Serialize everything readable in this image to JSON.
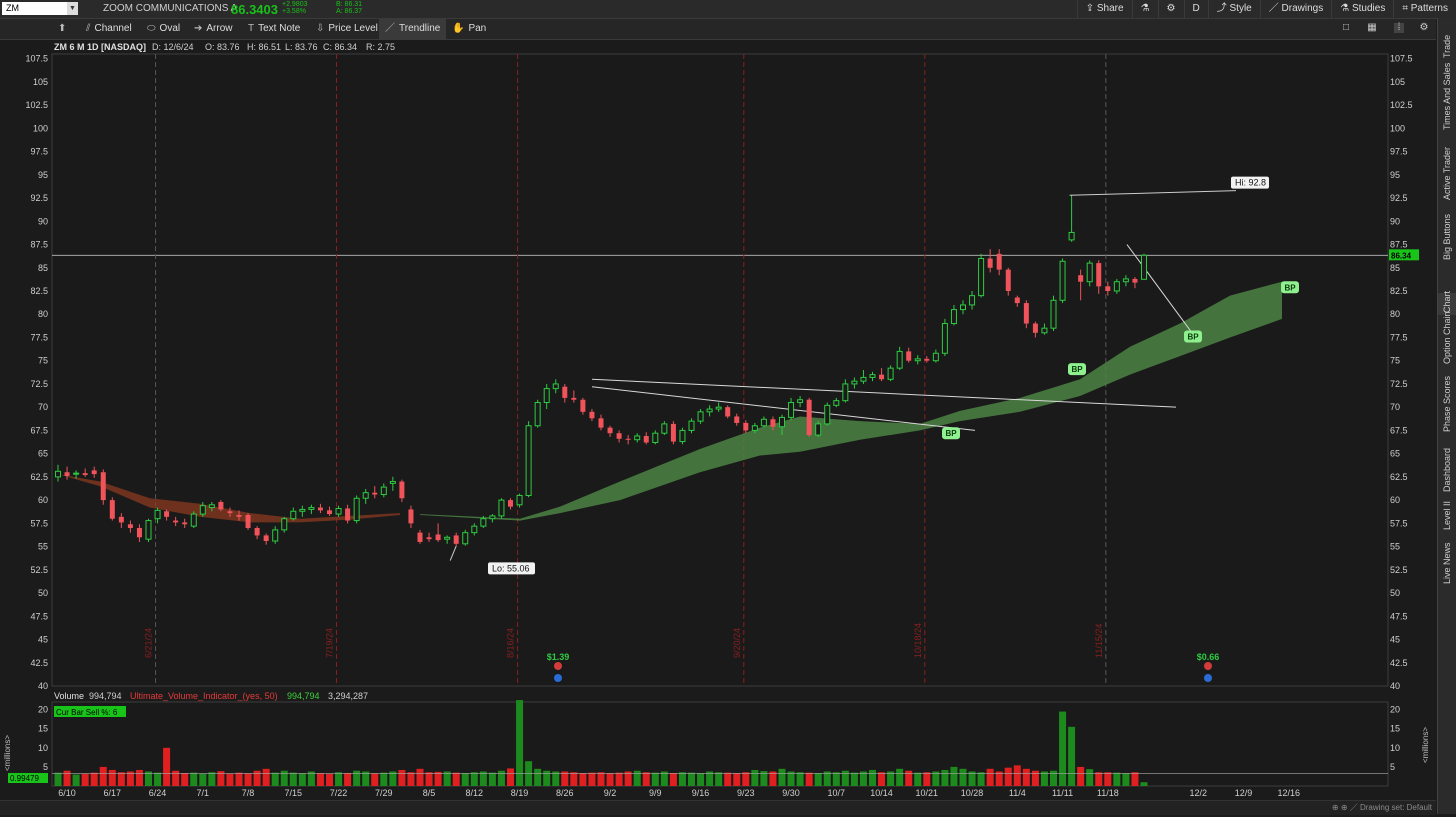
{
  "header": {
    "symbol": "ZM",
    "company": "ZOOM COMMUNICATIONS A",
    "last": "86.3403",
    "change": "+2.9803",
    "change_pct": "+3.58%",
    "bid": "B: 86.31",
    "ask": "A: 86.37",
    "buttons": [
      "Share",
      "D",
      "Style",
      "Drawings",
      "Studies",
      "Patterns"
    ]
  },
  "drawing_tools": [
    "Channel",
    "Oval",
    "Arrow",
    "Text Note",
    "Price Level",
    "Trendline",
    "Pan"
  ],
  "active_tool": "Trendline",
  "sidebar_tabs": [
    "Trade",
    "Times And Sales",
    "Active Trader",
    "Big Buttons",
    "Chart",
    "Option Chain",
    "Phase Scores",
    "Dashboard",
    "Level II",
    "Live News"
  ],
  "chart_data": {
    "type": "candlestick",
    "info": {
      "title": "ZM 6 M 1D [NASDAQ]",
      "date": "D: 12/6/24",
      "open": "O: 83.76",
      "high": "H: 86.51",
      "low": "L: 83.76",
      "close": "C: 86.34",
      "range": "R: 2.75"
    },
    "y_ticks": [
      "107.5",
      "105",
      "102.5",
      "100",
      "97.5",
      "95",
      "92.5",
      "90",
      "87.5",
      "85",
      "82.5",
      "80",
      "77.5",
      "75",
      "72.5",
      "70",
      "67.5",
      "65",
      "62.5",
      "60",
      "57.5",
      "55",
      "52.5",
      "50",
      "47.5",
      "45",
      "42.5",
      "40"
    ],
    "ylim": [
      40,
      108
    ],
    "x_ticks": [
      "6/10",
      "6/17",
      "6/24",
      "7/1",
      "7/8",
      "7/15",
      "7/22",
      "7/29",
      "8/5",
      "8/12",
      "8/19",
      "8/26",
      "9/2",
      "9/9",
      "9/16",
      "9/23",
      "9/30",
      "10/7",
      "10/14",
      "10/21",
      "10/28",
      "11/4",
      "11/11",
      "11/18",
      "12/2",
      "12/9",
      "12/16"
    ],
    "marker_dates": [
      "6/21/24",
      "7/19/24",
      "8/16/24",
      "9/20/24",
      "10/18/24",
      "11/15/24"
    ],
    "last_price_label": "86.34",
    "hi_label": "Hi: 92.8",
    "lo_label": "Lo: 55.06",
    "earnings": [
      "$1.39",
      "$0.66"
    ],
    "bp_labels": [
      "BP",
      "BP",
      "BP",
      "BP"
    ],
    "candles": [
      {
        "o": 62.5,
        "h": 63.8,
        "l": 62.0,
        "c": 63.1
      },
      {
        "o": 63.0,
        "h": 63.6,
        "l": 62.2,
        "c": 62.6
      },
      {
        "o": 62.8,
        "h": 63.2,
        "l": 62.3,
        "c": 62.9
      },
      {
        "o": 62.9,
        "h": 63.4,
        "l": 62.5,
        "c": 62.7
      },
      {
        "o": 63.2,
        "h": 63.6,
        "l": 62.4,
        "c": 62.8
      },
      {
        "o": 63.0,
        "h": 63.3,
        "l": 59.5,
        "c": 60.0
      },
      {
        "o": 60.0,
        "h": 60.3,
        "l": 57.8,
        "c": 58.0
      },
      {
        "o": 58.2,
        "h": 58.6,
        "l": 57.0,
        "c": 57.6
      },
      {
        "o": 57.4,
        "h": 57.8,
        "l": 56.5,
        "c": 57.0
      },
      {
        "o": 57.0,
        "h": 57.4,
        "l": 55.5,
        "c": 56.0
      },
      {
        "o": 55.8,
        "h": 58.0,
        "l": 55.5,
        "c": 57.8
      },
      {
        "o": 58.0,
        "h": 59.2,
        "l": 57.5,
        "c": 58.9
      },
      {
        "o": 58.8,
        "h": 59.0,
        "l": 57.8,
        "c": 58.2
      },
      {
        "o": 57.8,
        "h": 58.2,
        "l": 57.2,
        "c": 57.6
      },
      {
        "o": 57.6,
        "h": 58.0,
        "l": 57.0,
        "c": 57.4
      },
      {
        "o": 57.2,
        "h": 58.8,
        "l": 57.0,
        "c": 58.5
      },
      {
        "o": 58.5,
        "h": 59.8,
        "l": 58.2,
        "c": 59.4
      },
      {
        "o": 59.2,
        "h": 59.8,
        "l": 58.8,
        "c": 59.5
      },
      {
        "o": 59.8,
        "h": 60.0,
        "l": 58.8,
        "c": 59.0
      },
      {
        "o": 58.8,
        "h": 59.2,
        "l": 58.2,
        "c": 58.6
      },
      {
        "o": 58.4,
        "h": 58.9,
        "l": 57.8,
        "c": 58.2
      },
      {
        "o": 58.4,
        "h": 58.6,
        "l": 56.8,
        "c": 57.0
      },
      {
        "o": 57.0,
        "h": 57.2,
        "l": 55.8,
        "c": 56.2
      },
      {
        "o": 56.2,
        "h": 56.4,
        "l": 55.2,
        "c": 55.6
      },
      {
        "o": 55.6,
        "h": 57.2,
        "l": 55.3,
        "c": 56.8
      },
      {
        "o": 56.8,
        "h": 58.2,
        "l": 56.5,
        "c": 58.0
      },
      {
        "o": 58.0,
        "h": 59.2,
        "l": 57.8,
        "c": 58.8
      },
      {
        "o": 58.8,
        "h": 59.4,
        "l": 58.2,
        "c": 59.0
      },
      {
        "o": 59.0,
        "h": 59.5,
        "l": 58.5,
        "c": 59.2
      },
      {
        "o": 59.2,
        "h": 59.6,
        "l": 58.6,
        "c": 58.9
      },
      {
        "o": 58.9,
        "h": 59.3,
        "l": 58.3,
        "c": 58.5
      },
      {
        "o": 58.5,
        "h": 59.4,
        "l": 58.2,
        "c": 59.1
      },
      {
        "o": 59.1,
        "h": 59.5,
        "l": 57.5,
        "c": 57.8
      },
      {
        "o": 57.8,
        "h": 60.5,
        "l": 57.5,
        "c": 60.2
      },
      {
        "o": 60.2,
        "h": 61.2,
        "l": 59.6,
        "c": 60.8
      },
      {
        "o": 60.8,
        "h": 61.5,
        "l": 60.2,
        "c": 60.6
      },
      {
        "o": 60.6,
        "h": 61.8,
        "l": 60.3,
        "c": 61.4
      },
      {
        "o": 61.8,
        "h": 62.5,
        "l": 61.0,
        "c": 62.0
      },
      {
        "o": 62.0,
        "h": 62.2,
        "l": 59.8,
        "c": 60.2
      },
      {
        "o": 59.0,
        "h": 59.4,
        "l": 57.0,
        "c": 57.5
      },
      {
        "o": 56.5,
        "h": 56.8,
        "l": 55.3,
        "c": 55.5
      },
      {
        "o": 56.0,
        "h": 56.5,
        "l": 55.5,
        "c": 55.8
      },
      {
        "o": 56.3,
        "h": 57.5,
        "l": 55.5,
        "c": 55.7
      },
      {
        "o": 55.8,
        "h": 56.2,
        "l": 55.3,
        "c": 56.0
      },
      {
        "o": 56.2,
        "h": 56.5,
        "l": 55.06,
        "c": 55.3
      },
      {
        "o": 55.3,
        "h": 56.8,
        "l": 55.1,
        "c": 56.5
      },
      {
        "o": 56.5,
        "h": 57.5,
        "l": 56.2,
        "c": 57.2
      },
      {
        "o": 57.2,
        "h": 58.3,
        "l": 57.0,
        "c": 58.0
      },
      {
        "o": 58.0,
        "h": 58.5,
        "l": 57.6,
        "c": 58.3
      },
      {
        "o": 58.3,
        "h": 60.2,
        "l": 58.0,
        "c": 60.0
      },
      {
        "o": 60.0,
        "h": 60.2,
        "l": 59.0,
        "c": 59.3
      },
      {
        "o": 59.5,
        "h": 60.7,
        "l": 59.2,
        "c": 60.5
      },
      {
        "o": 60.5,
        "h": 68.5,
        "l": 60.3,
        "c": 68.0
      },
      {
        "o": 68.0,
        "h": 70.8,
        "l": 67.8,
        "c": 70.5
      },
      {
        "o": 70.5,
        "h": 72.5,
        "l": 69.8,
        "c": 72.0
      },
      {
        "o": 72.0,
        "h": 73.0,
        "l": 71.5,
        "c": 72.5
      },
      {
        "o": 72.2,
        "h": 72.5,
        "l": 70.5,
        "c": 71.0
      },
      {
        "o": 71.0,
        "h": 71.8,
        "l": 70.5,
        "c": 70.8
      },
      {
        "o": 70.8,
        "h": 71.0,
        "l": 69.2,
        "c": 69.5
      },
      {
        "o": 69.5,
        "h": 69.8,
        "l": 68.5,
        "c": 68.8
      },
      {
        "o": 68.8,
        "h": 69.2,
        "l": 67.5,
        "c": 67.8
      },
      {
        "o": 67.8,
        "h": 68.0,
        "l": 66.8,
        "c": 67.2
      },
      {
        "o": 67.2,
        "h": 67.5,
        "l": 66.2,
        "c": 66.6
      },
      {
        "o": 66.6,
        "h": 67.0,
        "l": 66.0,
        "c": 66.5
      },
      {
        "o": 66.5,
        "h": 67.2,
        "l": 66.2,
        "c": 66.9
      },
      {
        "o": 66.9,
        "h": 67.3,
        "l": 66.0,
        "c": 66.2
      },
      {
        "o": 66.2,
        "h": 67.5,
        "l": 66.0,
        "c": 67.2
      },
      {
        "o": 67.2,
        "h": 68.5,
        "l": 67.0,
        "c": 68.2
      },
      {
        "o": 68.2,
        "h": 68.5,
        "l": 66.0,
        "c": 66.3
      },
      {
        "o": 66.3,
        "h": 67.8,
        "l": 66.0,
        "c": 67.5
      },
      {
        "o": 67.5,
        "h": 68.8,
        "l": 67.2,
        "c": 68.5
      },
      {
        "o": 68.5,
        "h": 69.8,
        "l": 68.2,
        "c": 69.5
      },
      {
        "o": 69.5,
        "h": 70.2,
        "l": 69.0,
        "c": 69.8
      },
      {
        "o": 69.8,
        "h": 70.5,
        "l": 69.5,
        "c": 70.0
      },
      {
        "o": 70.0,
        "h": 70.2,
        "l": 68.8,
        "c": 69.0
      },
      {
        "o": 69.0,
        "h": 69.3,
        "l": 68.0,
        "c": 68.3
      },
      {
        "o": 68.3,
        "h": 68.6,
        "l": 67.2,
        "c": 67.5
      },
      {
        "o": 67.5,
        "h": 68.3,
        "l": 67.2,
        "c": 68.0
      },
      {
        "o": 68.0,
        "h": 69.0,
        "l": 67.8,
        "c": 68.7
      },
      {
        "o": 68.7,
        "h": 69.0,
        "l": 67.5,
        "c": 67.9
      },
      {
        "o": 67.9,
        "h": 69.2,
        "l": 67.0,
        "c": 68.9
      },
      {
        "o": 68.9,
        "h": 71.0,
        "l": 68.6,
        "c": 70.5
      },
      {
        "o": 70.5,
        "h": 71.2,
        "l": 70.0,
        "c": 70.8
      },
      {
        "o": 70.8,
        "h": 71.0,
        "l": 66.8,
        "c": 67.0
      },
      {
        "o": 67.0,
        "h": 68.5,
        "l": 66.8,
        "c": 68.2
      },
      {
        "o": 68.2,
        "h": 70.5,
        "l": 68.0,
        "c": 70.2
      },
      {
        "o": 70.2,
        "h": 71.0,
        "l": 70.0,
        "c": 70.7
      },
      {
        "o": 70.7,
        "h": 73.0,
        "l": 70.5,
        "c": 72.5
      },
      {
        "o": 72.5,
        "h": 73.2,
        "l": 72.0,
        "c": 72.8
      },
      {
        "o": 72.8,
        "h": 74.0,
        "l": 72.5,
        "c": 73.2
      },
      {
        "o": 73.2,
        "h": 73.8,
        "l": 72.8,
        "c": 73.5
      },
      {
        "o": 73.5,
        "h": 74.2,
        "l": 72.8,
        "c": 73.0
      },
      {
        "o": 73.0,
        "h": 74.5,
        "l": 72.8,
        "c": 74.2
      },
      {
        "o": 74.2,
        "h": 76.5,
        "l": 74.0,
        "c": 76.0
      },
      {
        "o": 76.0,
        "h": 76.4,
        "l": 74.8,
        "c": 75.0
      },
      {
        "o": 75.0,
        "h": 75.6,
        "l": 74.6,
        "c": 75.2
      },
      {
        "o": 75.2,
        "h": 75.5,
        "l": 74.8,
        "c": 75.0
      },
      {
        "o": 75.0,
        "h": 76.2,
        "l": 74.8,
        "c": 75.8
      },
      {
        "o": 75.8,
        "h": 79.5,
        "l": 75.5,
        "c": 79.0
      },
      {
        "o": 79.0,
        "h": 81.0,
        "l": 78.8,
        "c": 80.5
      },
      {
        "o": 80.5,
        "h": 81.5,
        "l": 80.0,
        "c": 81.0
      },
      {
        "o": 81.0,
        "h": 82.5,
        "l": 80.5,
        "c": 82.0
      },
      {
        "o": 82.0,
        "h": 86.5,
        "l": 81.8,
        "c": 86.0
      },
      {
        "o": 86.0,
        "h": 87.0,
        "l": 84.5,
        "c": 85.0
      },
      {
        "o": 86.5,
        "h": 87.0,
        "l": 84.2,
        "c": 84.8
      },
      {
        "o": 84.8,
        "h": 85.0,
        "l": 82.0,
        "c": 82.5
      },
      {
        "o": 81.8,
        "h": 82.0,
        "l": 80.8,
        "c": 81.2
      },
      {
        "o": 81.2,
        "h": 81.5,
        "l": 78.5,
        "c": 79.0
      },
      {
        "o": 79.0,
        "h": 79.2,
        "l": 77.5,
        "c": 78.0
      },
      {
        "o": 78.0,
        "h": 79.0,
        "l": 77.8,
        "c": 78.5
      },
      {
        "o": 78.5,
        "h": 82.0,
        "l": 78.2,
        "c": 81.5
      },
      {
        "o": 81.5,
        "h": 86.0,
        "l": 81.2,
        "c": 85.7
      },
      {
        "o": 88.0,
        "h": 92.8,
        "l": 87.8,
        "c": 88.8
      },
      {
        "o": 84.2,
        "h": 84.8,
        "l": 81.5,
        "c": 83.5
      },
      {
        "o": 83.5,
        "h": 85.8,
        "l": 83.0,
        "c": 85.5
      },
      {
        "o": 85.5,
        "h": 85.8,
        "l": 82.2,
        "c": 83.0
      },
      {
        "o": 83.0,
        "h": 83.5,
        "l": 82.0,
        "c": 82.5
      },
      {
        "o": 82.5,
        "h": 83.8,
        "l": 82.2,
        "c": 83.5
      },
      {
        "o": 83.5,
        "h": 84.2,
        "l": 83.0,
        "c": 83.8
      },
      {
        "o": 83.8,
        "h": 84.0,
        "l": 82.8,
        "c": 83.4
      },
      {
        "o": 83.76,
        "h": 86.51,
        "l": 83.76,
        "c": 86.34
      }
    ],
    "volume": {
      "label": "Volume",
      "value": "994,794",
      "indicator": "Ultimate_Volume_Indicator_(yes, 50)",
      "indicator_value": "994,794",
      "avg": "3,294,287",
      "cur_bar_sell": "Cur Bar Sell %: 6",
      "last_label": "0.99479",
      "axis_label": "<millions>",
      "y_ticks": [
        "20",
        "15",
        "10",
        "5"
      ],
      "ylim": [
        0,
        22
      ],
      "values": [
        3.5,
        4,
        3,
        3.2,
        3.5,
        5,
        4.2,
        3.6,
        3.8,
        4.2,
        3.8,
        3.5,
        10,
        4,
        3.4,
        3.5,
        3.2,
        3.6,
        3.9,
        3.2,
        3.5,
        3.3,
        4,
        4.5,
        3.5,
        4,
        3.5,
        3.3,
        3.8,
        3.4,
        3.2,
        3.6,
        3.4,
        4,
        3.8,
        3.3,
        3.5,
        3.8,
        4.2,
        3.6,
        4.5,
        3.6,
        3.7,
        3.8,
        3.5,
        3.4,
        3.6,
        3.8,
        3.5,
        4,
        4.6,
        22.5,
        6.5,
        4.5,
        4,
        3.8,
        3.8,
        3.6,
        3.4,
        3.5,
        3.6,
        3.4,
        3.5,
        3.8,
        4,
        3.6,
        3.5,
        3.8,
        3.4,
        3.6,
        3.5,
        3.4,
        3.8,
        3.6,
        3.5,
        3.4,
        3.6,
        4.2,
        3.9,
        3.8,
        4.5,
        3.8,
        3.6,
        3.5,
        3.4,
        3.8,
        3.6,
        4,
        3.5,
        3.8,
        4.2,
        3.6,
        3.8,
        4.5,
        4,
        3.5,
        3.6,
        3.8,
        4.2,
        5,
        4.5,
        3.8,
        3.6,
        4.5,
        3.8,
        4.8,
        5.4,
        4.5,
        4,
        3.8,
        4,
        19.5,
        15.5,
        5,
        4.4,
        3.6,
        3.6,
        3.5,
        3.4,
        3.6,
        1
      ]
    }
  }
}
